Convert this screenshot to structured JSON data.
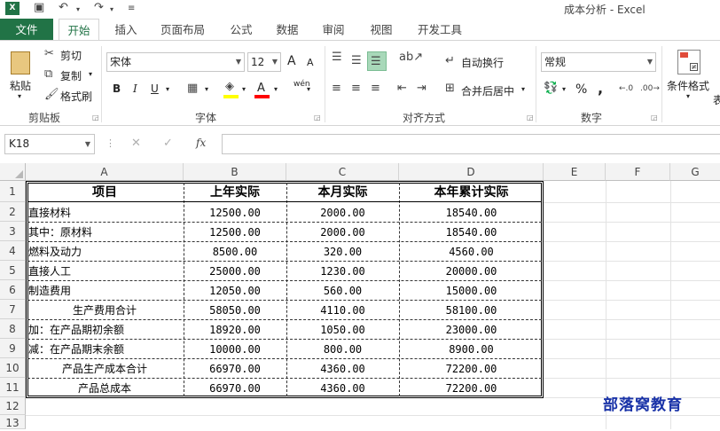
{
  "titlebar": {
    "app_icon": "X",
    "title": "成本分析 - Excel"
  },
  "tabs": [
    "文件",
    "开始",
    "插入",
    "页面布局",
    "公式",
    "数据",
    "审阅",
    "视图",
    "开发工具"
  ],
  "clipboard": {
    "paste": "粘贴",
    "cut": "剪切",
    "copy": "复制",
    "format_painter": "格式刷",
    "group": "剪贴板"
  },
  "font": {
    "name": "宋体",
    "size": "12",
    "group": "字体",
    "bold": "B",
    "italic": "I",
    "underline": "U",
    "grow": "A",
    "shrink": "A",
    "font_color": "A",
    "phonetic": "wén"
  },
  "alignment": {
    "wrap": "自动换行",
    "merge": "合并后居中",
    "group": "对齐方式"
  },
  "number": {
    "format": "常规",
    "group": "数字",
    "percent": "%",
    "comma": ","
  },
  "styles": {
    "conditional": "条件格式",
    "partial": "表"
  },
  "formula_bar": {
    "name_box": "K18",
    "fx": "fx",
    "cancel": "✕",
    "enter": "✓"
  },
  "columns": [
    "A",
    "B",
    "C",
    "D",
    "E",
    "F",
    "G"
  ],
  "rows": [
    "1",
    "2",
    "3",
    "4",
    "5",
    "6",
    "7",
    "8",
    "9",
    "10",
    "11",
    "12",
    "13"
  ],
  "table": {
    "headers": [
      "项目",
      "上年实际",
      "本月实际",
      "本年累计实际"
    ],
    "body": [
      [
        "直接材料",
        "12500.00",
        "2000.00",
        "18540.00"
      ],
      [
        "其中：原材料",
        "12500.00",
        "2000.00",
        "18540.00"
      ],
      [
        "燃料及动力",
        "8500.00",
        "320.00",
        "4560.00"
      ],
      [
        "直接人工",
        "25000.00",
        "1230.00",
        "20000.00"
      ],
      [
        "制造费用",
        "12050.00",
        "560.00",
        "15000.00"
      ],
      [
        "生产费用合计",
        "58050.00",
        "4110.00",
        "58100.00"
      ],
      [
        "加：在产品期初余额",
        "18920.00",
        "1050.00",
        "23000.00"
      ],
      [
        "减：在产品期末余额",
        "10000.00",
        "800.00",
        "8900.00"
      ],
      [
        "产品生产成本合计",
        "66970.00",
        "4360.00",
        "72200.00"
      ],
      [
        "产品总成本",
        "66970.00",
        "4360.00",
        "72200.00"
      ]
    ]
  },
  "watermark": "部落窝教育"
}
